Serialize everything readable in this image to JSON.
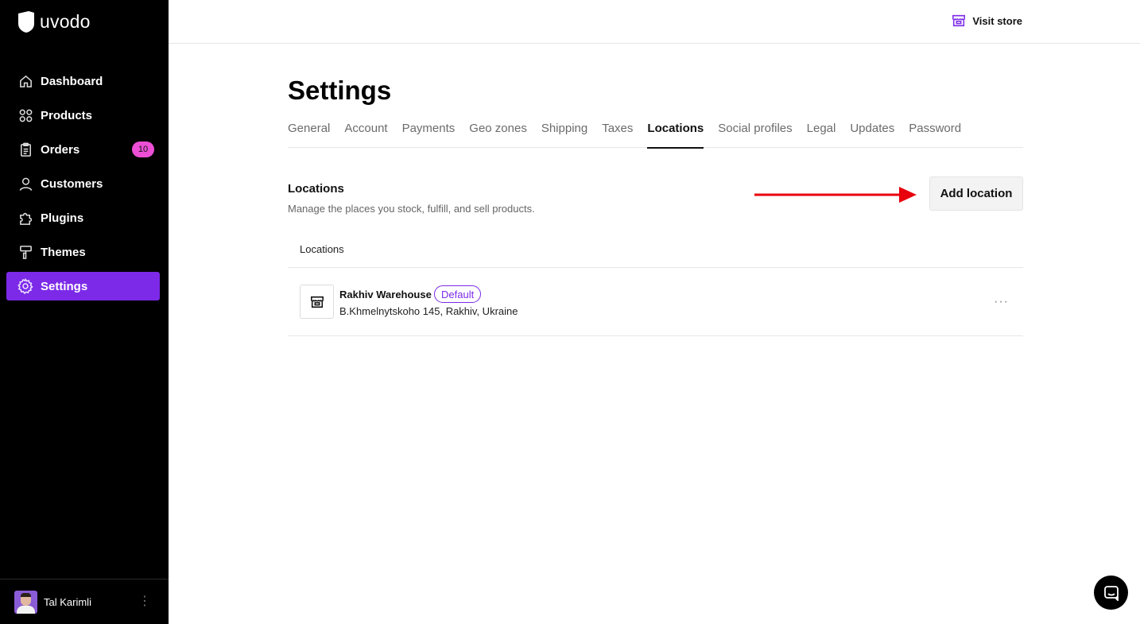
{
  "app": {
    "logo_text": "uvodo"
  },
  "sidebar": {
    "items": [
      {
        "label": "Dashboard",
        "icon": "home-icon"
      },
      {
        "label": "Products",
        "icon": "grid-icon"
      },
      {
        "label": "Orders",
        "icon": "clipboard-icon",
        "badge": "10"
      },
      {
        "label": "Customers",
        "icon": "user-icon"
      },
      {
        "label": "Plugins",
        "icon": "puzzle-icon"
      },
      {
        "label": "Themes",
        "icon": "paint-roller-icon"
      },
      {
        "label": "Settings",
        "icon": "gear-icon",
        "active": true
      }
    ],
    "user": {
      "name": "Tal Karimli"
    }
  },
  "topbar": {
    "visit_store_label": "Visit store"
  },
  "page": {
    "title": "Settings"
  },
  "tabs": [
    {
      "label": "General"
    },
    {
      "label": "Account"
    },
    {
      "label": "Payments"
    },
    {
      "label": "Geo zones"
    },
    {
      "label": "Shipping"
    },
    {
      "label": "Taxes"
    },
    {
      "label": "Locations",
      "active": true
    },
    {
      "label": "Social profiles"
    },
    {
      "label": "Legal"
    },
    {
      "label": "Updates"
    },
    {
      "label": "Password"
    }
  ],
  "locations_section": {
    "title": "Locations",
    "description": "Manage the places you stock, fulfill, and sell products.",
    "add_button_label": "Add location",
    "table_header": "Locations",
    "rows": [
      {
        "name": "Rakhiv Warehouse",
        "badge": "Default",
        "address": "B.Khmelnytskoho 145, Rakhiv, Ukraine",
        "menu": "···"
      }
    ]
  },
  "colors": {
    "accent": "#7c2ae8",
    "badge_pink": "#ec4fd6",
    "annotation_arrow": "#e8000d"
  }
}
